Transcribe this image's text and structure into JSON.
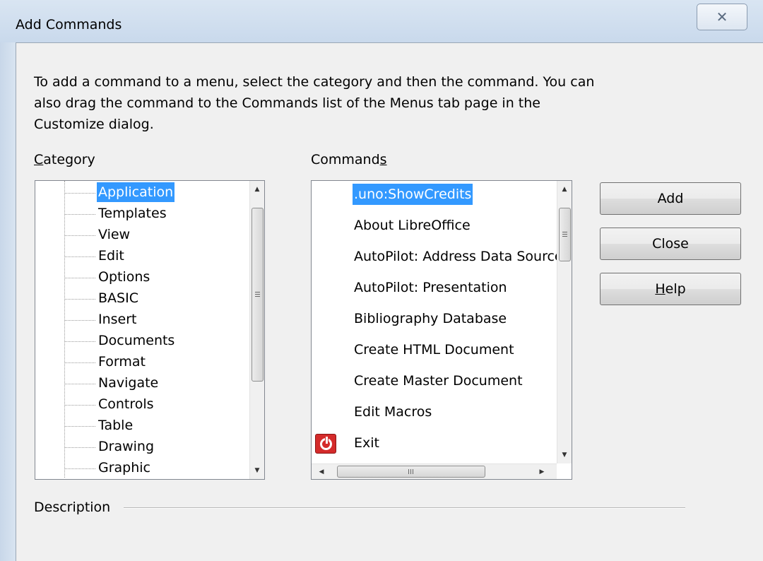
{
  "window": {
    "title": "Add Commands",
    "close_glyph": "✕"
  },
  "intro_text": "To add a command to a menu, select the category and then the command. You can also drag the command to the Commands list of the Menus tab page in the Customize dialog.",
  "category": {
    "label_first": "C",
    "label_rest": "ategory",
    "items": [
      "Application",
      "Templates",
      "View",
      "Edit",
      "Options",
      "BASIC",
      "Insert",
      "Documents",
      "Format",
      "Navigate",
      "Controls",
      "Table",
      "Drawing",
      "Graphic"
    ],
    "selected": "Application"
  },
  "commands": {
    "label_start": "Command",
    "label_ul": "s",
    "items": [
      ".uno:ShowCredits",
      "About LibreOffice",
      "AutoPilot: Address Data Source",
      "AutoPilot: Presentation",
      "Bibliography Database",
      "Create HTML Document",
      "Create Master Document",
      "Edit Macros",
      "Exit"
    ],
    "selected": ".uno:ShowCredits",
    "exit_icon": "power-icon"
  },
  "buttons": {
    "add": "Add",
    "close": "Close",
    "help_first": "H",
    "help_rest": "elp"
  },
  "description": {
    "label": "Description"
  },
  "colors": {
    "selection": "#3399ff",
    "exit_icon": "#d42b2b"
  }
}
